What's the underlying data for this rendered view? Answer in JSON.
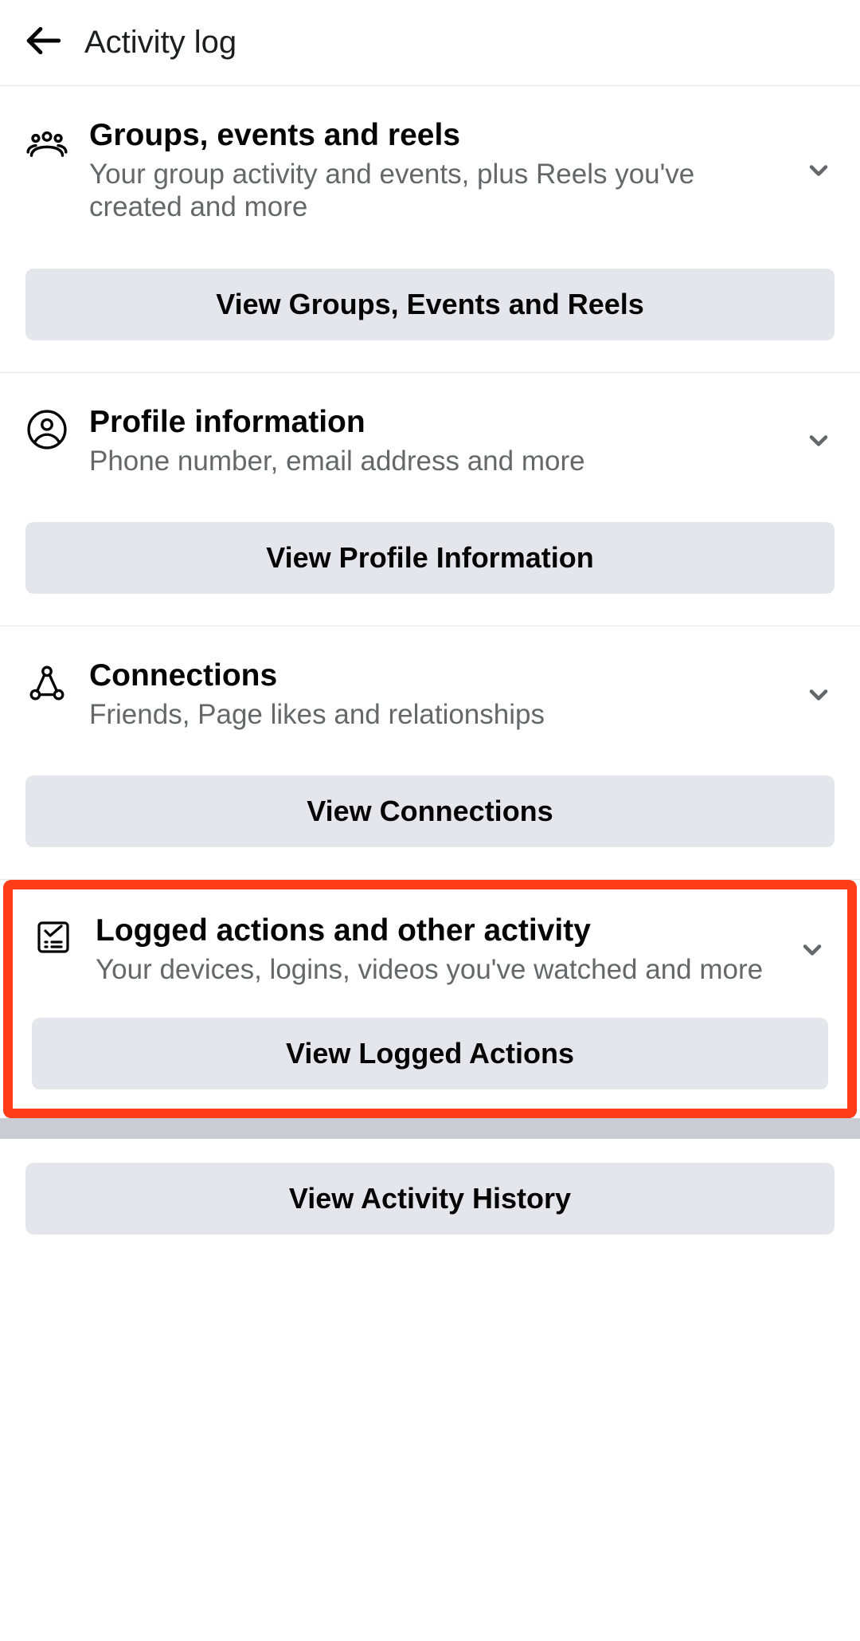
{
  "header": {
    "title": "Activity log"
  },
  "sections": [
    {
      "title": "Groups, events and reels",
      "subtitle": "Your group activity and events, plus Reels you've created and more",
      "button_label": "View Groups, Events and Reels"
    },
    {
      "title": "Profile information",
      "subtitle": "Phone number, email address and more",
      "button_label": "View Profile Information"
    },
    {
      "title": "Connections",
      "subtitle": "Friends, Page likes and relationships",
      "button_label": "View Connections"
    },
    {
      "title": "Logged actions and other activity",
      "subtitle": "Your devices, logins, videos you've watched and more",
      "button_label": "View Logged Actions"
    }
  ],
  "bottom": {
    "button_label": "View Activity History"
  }
}
